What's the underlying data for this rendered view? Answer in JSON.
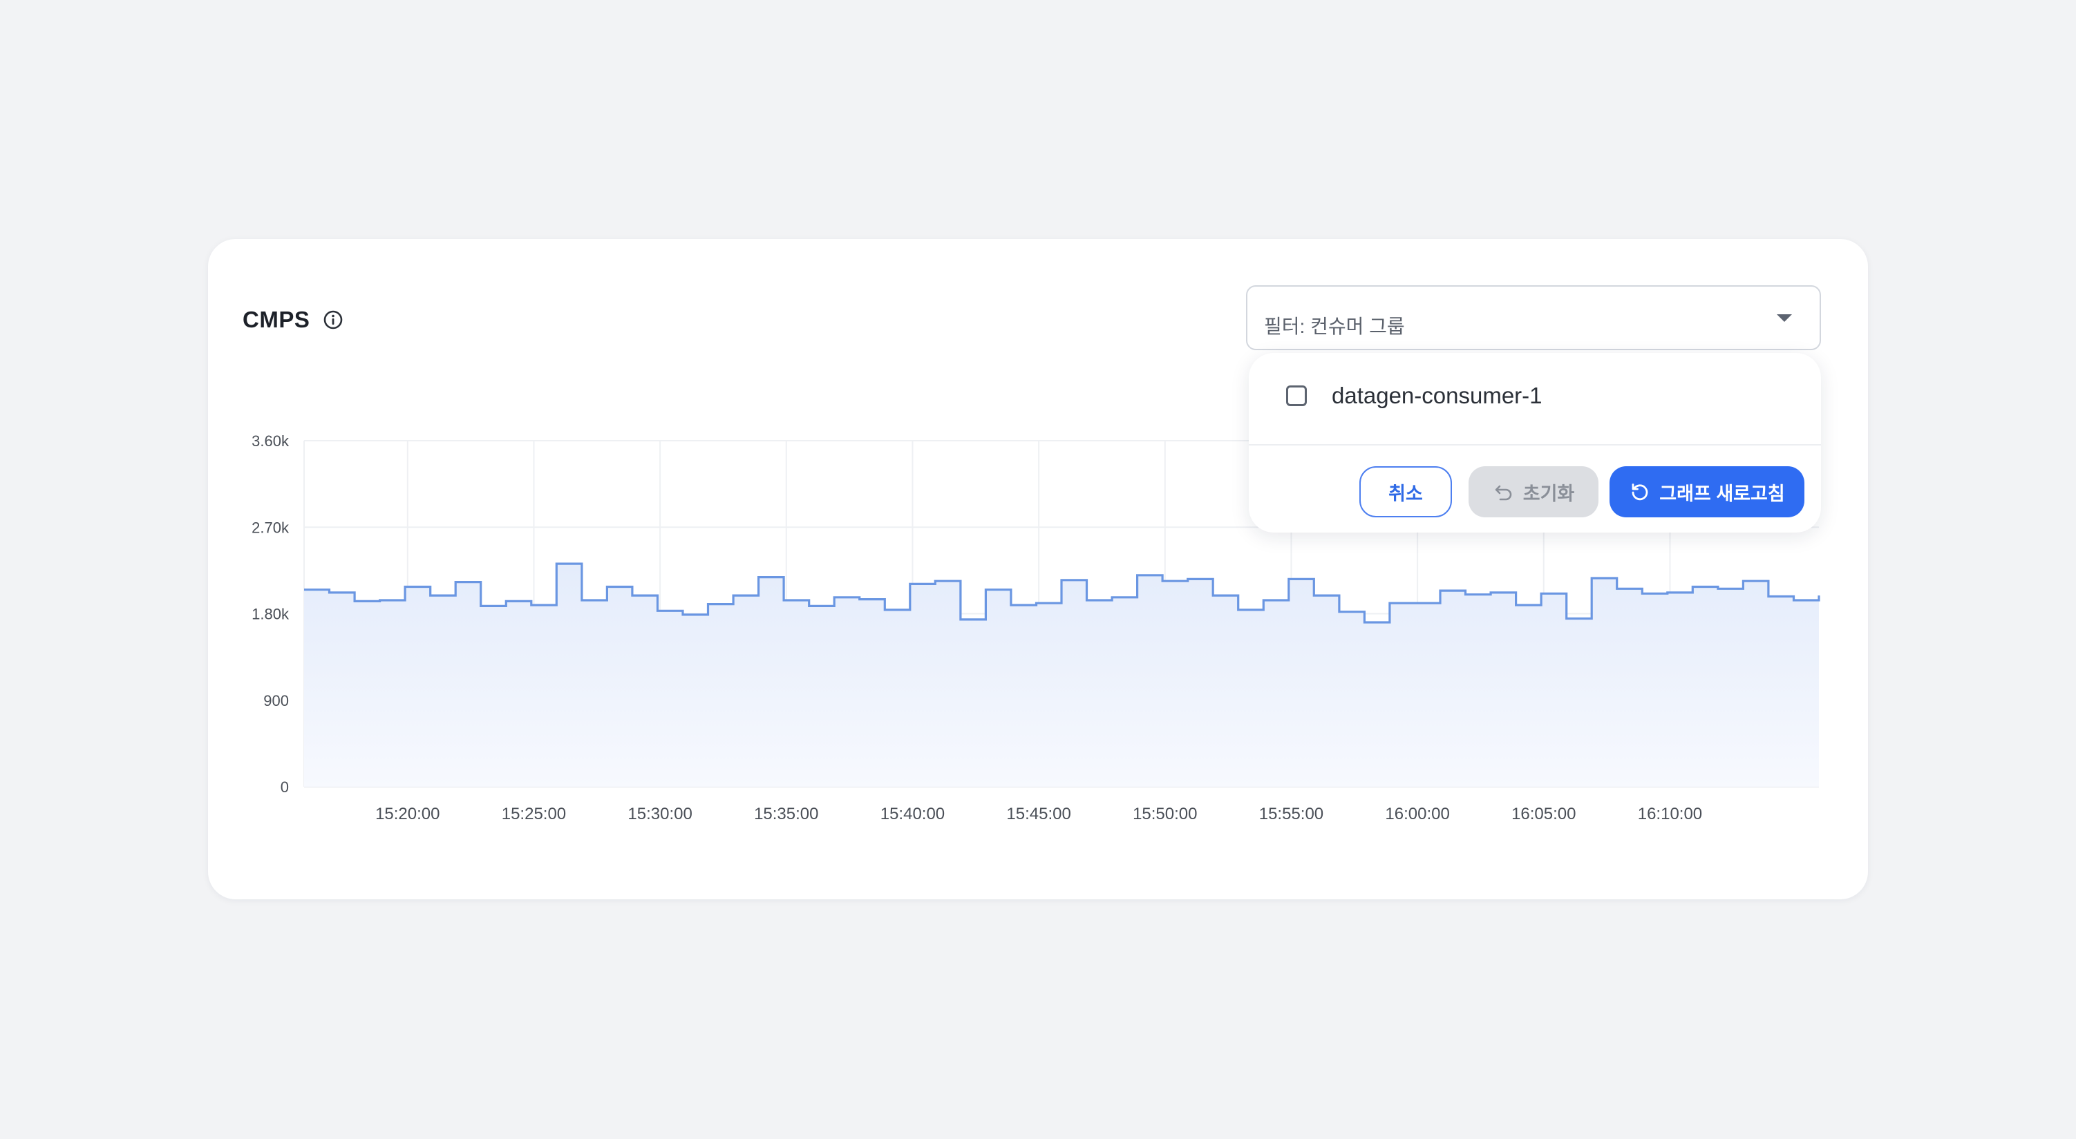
{
  "card": {
    "title": "CMPS",
    "info_icon": "info-circle-icon"
  },
  "filter": {
    "label": "필터: 컨슈머 그룹",
    "caret_icon": "caret-down-icon",
    "options": [
      {
        "label": "datagen-consumer-1",
        "checked": false
      }
    ],
    "cancel_label": "취소",
    "reset_label": "초기화",
    "reset_icon": "undo-icon",
    "refresh_label": "그래프 새로고침",
    "refresh_icon": "refresh-icon"
  },
  "colors": {
    "line": "#6a96e2",
    "area_top": "#e7eefb",
    "primary": "#2f6cf2"
  },
  "chart_data": {
    "type": "area",
    "title": "CMPS",
    "xlabel": "",
    "ylabel": "",
    "ylim": [
      0,
      3600
    ],
    "xlim": [
      "15:15:54",
      "16:15:54"
    ],
    "yticks": [
      0,
      900,
      1800,
      2700,
      3600
    ],
    "ytick_labels": [
      "0",
      "900",
      "1.80k",
      "2.70k",
      "3.60k"
    ],
    "xticks": [
      "15:20:00",
      "15:25:00",
      "15:30:00",
      "15:35:00",
      "15:40:00",
      "15:45:00",
      "15:50:00",
      "15:55:00",
      "16:00:00",
      "16:05:00",
      "16:10:00"
    ],
    "grid": true,
    "legend": "none",
    "step": true,
    "series": [
      {
        "x": [
          "15:15:54",
          "15:16:54",
          "15:17:54",
          "15:18:54",
          "15:19:54",
          "15:20:54",
          "15:21:54",
          "15:22:54",
          "15:23:54",
          "15:24:54",
          "15:25:54",
          "15:26:54",
          "15:27:54",
          "15:28:54",
          "15:29:54",
          "15:30:54",
          "15:31:54",
          "15:32:54",
          "15:33:54",
          "15:34:54",
          "15:35:54",
          "15:36:54",
          "15:37:54",
          "15:38:54",
          "15:39:54",
          "15:40:54",
          "15:41:54",
          "15:42:54",
          "15:43:54",
          "15:44:54",
          "15:45:54",
          "15:46:54",
          "15:47:54",
          "15:48:54",
          "15:49:54",
          "15:50:54",
          "15:51:54",
          "15:52:54",
          "15:53:54",
          "15:54:54",
          "15:55:54",
          "15:56:54",
          "15:57:54",
          "15:58:54",
          "15:59:54",
          "16:00:54",
          "16:01:54",
          "16:02:54",
          "16:03:54",
          "16:04:54",
          "16:05:54",
          "16:06:54",
          "16:07:54",
          "16:08:54",
          "16:09:54",
          "16:10:54",
          "16:11:54",
          "16:12:54",
          "16:13:54",
          "16:14:54",
          "16:15:54"
        ],
        "values": [
          2050,
          2020,
          1930,
          1940,
          2080,
          1990,
          2130,
          1880,
          1930,
          1890,
          2320,
          1940,
          2080,
          1990,
          1830,
          1790,
          1900,
          1990,
          2180,
          1940,
          1880,
          1970,
          1950,
          1840,
          2110,
          2140,
          1740,
          2050,
          1890,
          1910,
          2150,
          1940,
          1970,
          2200,
          2140,
          2160,
          1990,
          1840,
          1940,
          2160,
          1990,
          1820,
          1710,
          1910,
          1910,
          2040,
          2000,
          2020,
          1890,
          2010,
          1750,
          2170,
          2060,
          2010,
          2020,
          2080,
          2060,
          2140,
          1980,
          1940,
          1990
        ]
      }
    ]
  }
}
